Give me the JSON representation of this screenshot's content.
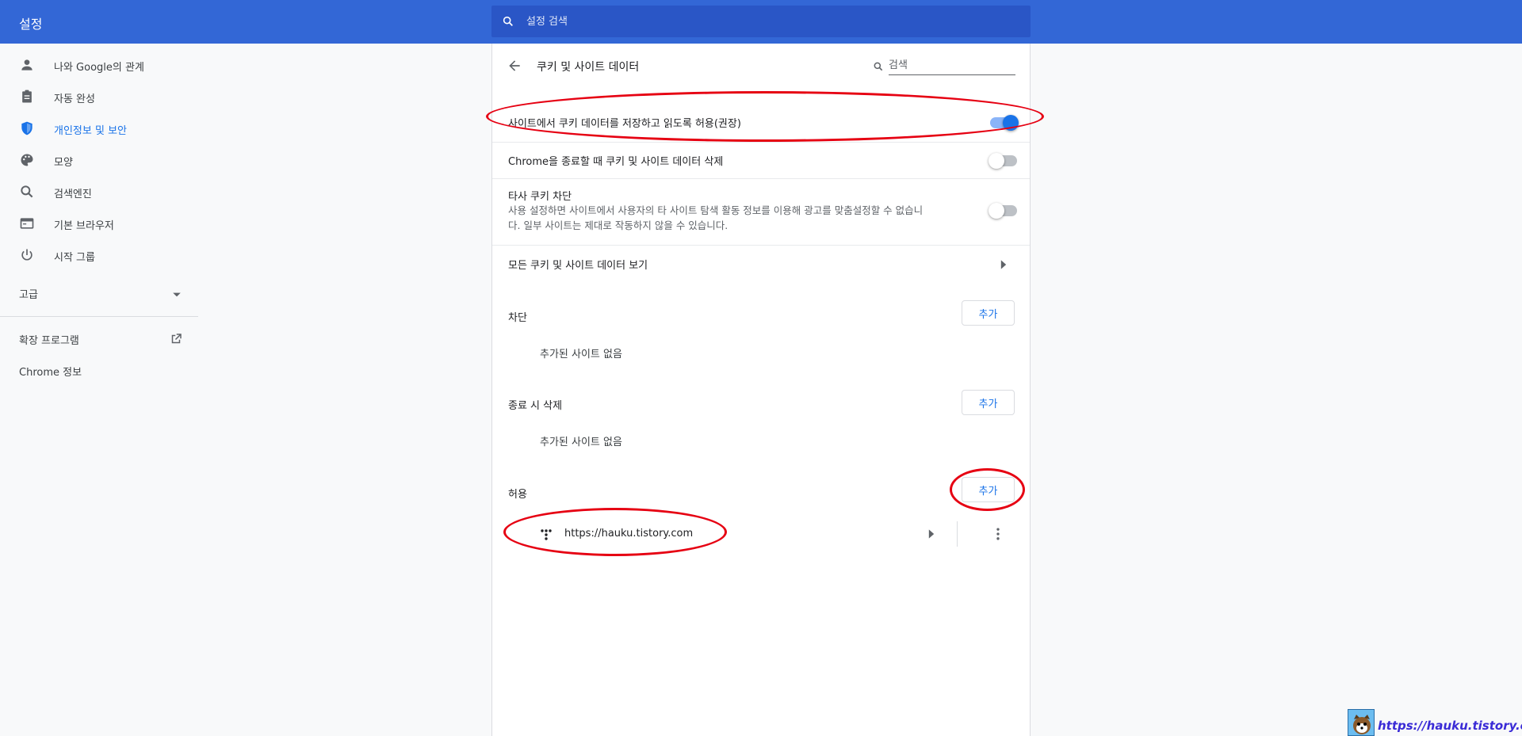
{
  "app": {
    "title": "설정"
  },
  "search": {
    "placeholder": "설정 검색"
  },
  "sidebar": {
    "items": [
      {
        "label": "나와 Google의 관계",
        "icon": "person-icon"
      },
      {
        "label": "자동 완성",
        "icon": "clipboard-icon"
      },
      {
        "label": "개인정보 및 보안",
        "icon": "shield-icon",
        "active": true
      },
      {
        "label": "모양",
        "icon": "palette-icon"
      },
      {
        "label": "검색엔진",
        "icon": "search-icon"
      },
      {
        "label": "기본 브라우저",
        "icon": "browser-icon"
      },
      {
        "label": "시작 그룹",
        "icon": "power-icon"
      }
    ],
    "advanced": "고급",
    "extensions": "확장 프로그램",
    "about": "Chrome 정보"
  },
  "page": {
    "title": "쿠키 및 사이트 데이터",
    "search_placeholder": "검색",
    "allow_cookies": {
      "label": "사이트에서 쿠키 데이터를 저장하고 읽도록 허용(권장)",
      "enabled": true
    },
    "clear_on_exit": {
      "label": "Chrome을 종료할 때 쿠키 및 사이트 데이터 삭제",
      "enabled": false
    },
    "block_third_party": {
      "label": "타사 쿠키 차단",
      "desc_line1": "사용 설정하면 사이트에서 사용자의 타 사이트 탐색 활동 정보를 이용해 광고를 맞춤설정할 수 없습니",
      "desc_line2": "다. 일부 사이트는 제대로 작동하지 않을 수 있습니다.",
      "enabled": false
    },
    "see_all": "모든 쿠키 및 사이트 데이터 보기",
    "block_section": {
      "title": "차단",
      "add_label": "추가",
      "empty": "추가된 사이트 없음"
    },
    "clear_section": {
      "title": "종료 시 삭제",
      "add_label": "추가",
      "empty": "추가된 사이트 없음"
    },
    "allow_section": {
      "title": "허용",
      "add_label": "추가",
      "sites": [
        {
          "url": "https://hauku.tistory.com"
        }
      ]
    }
  },
  "watermark": {
    "text": "https://hauku.tistory.com"
  },
  "colors": {
    "topbar": "#3367d6",
    "accent": "#1a73e8",
    "annotation": "#e60012"
  }
}
